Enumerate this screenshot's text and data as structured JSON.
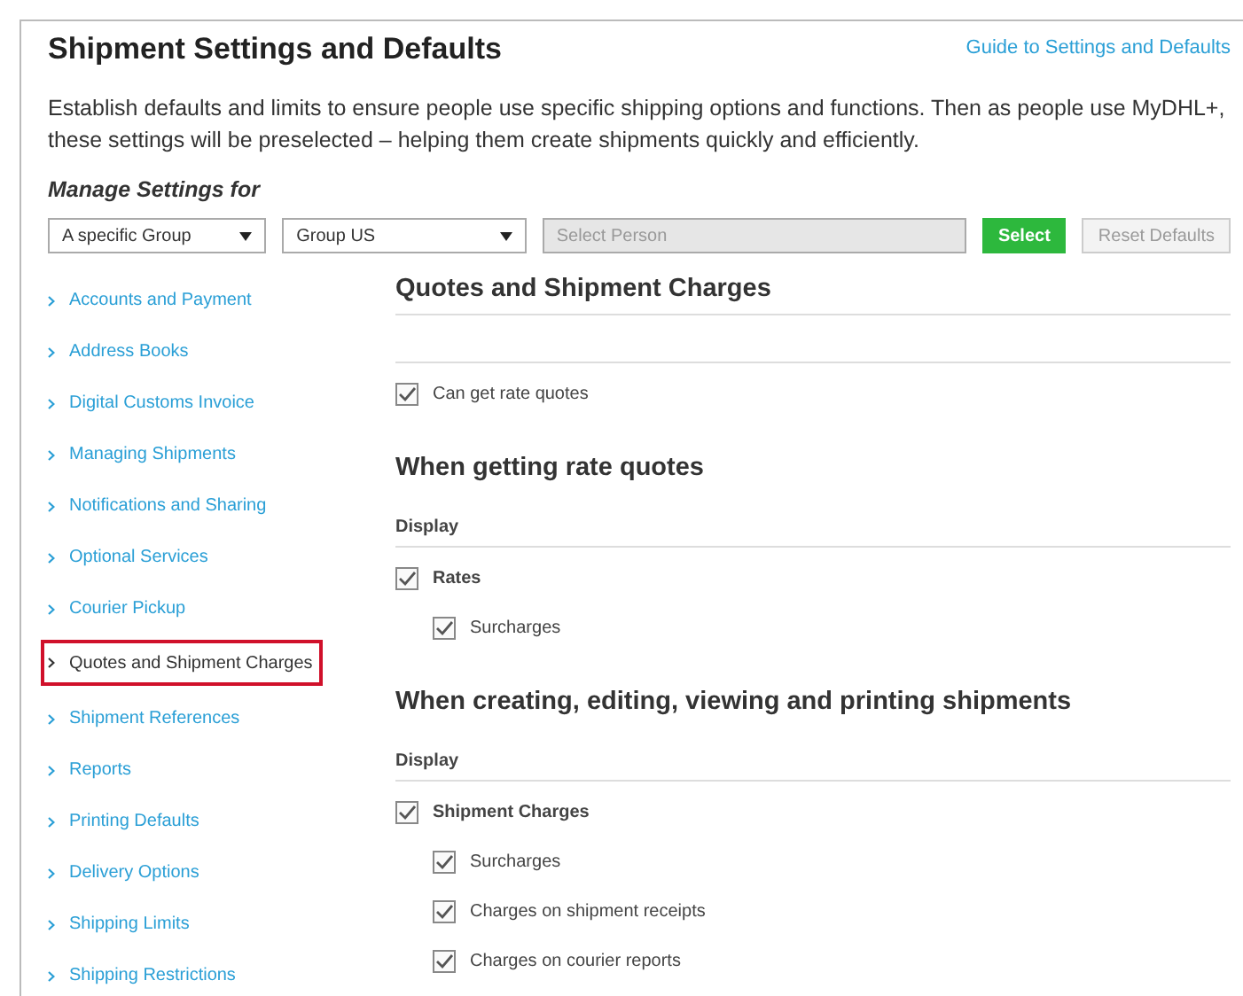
{
  "header": {
    "title": "Shipment Settings and Defaults",
    "guide_link": "Guide to Settings and Defaults",
    "intro": "Establish defaults and limits to ensure people use specific shipping options and functions. Then as people use MyDHL+, these settings will be preselected – helping them create shipments quickly and efficiently."
  },
  "manage": {
    "label": "Manage Settings for",
    "scope_select": {
      "value": "A specific Group"
    },
    "group_select": {
      "value": "Group US"
    },
    "person_field": {
      "placeholder": "Select Person",
      "disabled": true
    },
    "buttons": [
      {
        "label": "Select",
        "kind": "primary",
        "disabled": false
      },
      {
        "label": "Reset Defaults",
        "kind": "secondary",
        "disabled": true
      }
    ]
  },
  "sidebar": {
    "items": [
      {
        "label": "Accounts and Payment",
        "selected": false
      },
      {
        "label": "Address Books",
        "selected": false
      },
      {
        "label": "Digital Customs Invoice",
        "selected": false
      },
      {
        "label": "Managing Shipments",
        "selected": false
      },
      {
        "label": "Notifications and Sharing",
        "selected": false
      },
      {
        "label": "Optional Services",
        "selected": false
      },
      {
        "label": "Courier Pickup",
        "selected": false
      },
      {
        "label": "Quotes and Shipment Charges",
        "selected": true
      },
      {
        "label": "Shipment References",
        "selected": false
      },
      {
        "label": "Reports",
        "selected": false
      },
      {
        "label": "Printing Defaults",
        "selected": false
      },
      {
        "label": "Delivery Options",
        "selected": false
      },
      {
        "label": "Shipping Limits",
        "selected": false
      },
      {
        "label": "Shipping Restrictions",
        "selected": false
      }
    ]
  },
  "main": {
    "title": "Quotes and Shipment Charges",
    "sections": [
      {
        "options": [
          {
            "label": "Can get rate quotes",
            "checked": true
          }
        ]
      },
      {
        "heading": "When getting rate quotes",
        "display_label": "Display",
        "options": [
          {
            "label": "Rates",
            "checked": true,
            "children": [
              {
                "label": "Surcharges",
                "checked": true
              }
            ]
          }
        ]
      },
      {
        "heading": "When creating, editing, viewing and printing shipments",
        "display_label": "Display",
        "options": [
          {
            "label": "Shipment Charges",
            "checked": true,
            "children": [
              {
                "label": "Surcharges",
                "checked": true
              },
              {
                "label": "Charges on shipment receipts",
                "checked": true
              },
              {
                "label": "Charges on courier reports",
                "checked": true
              }
            ]
          }
        ]
      }
    ]
  }
}
